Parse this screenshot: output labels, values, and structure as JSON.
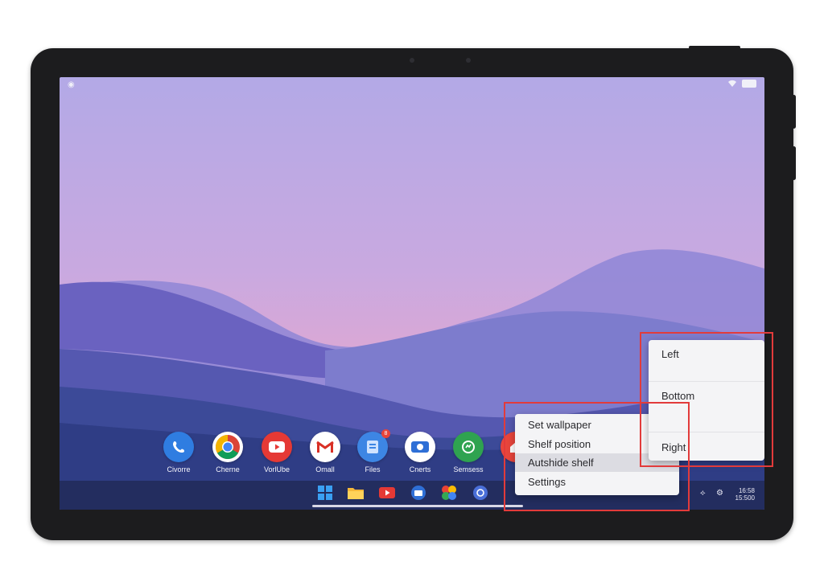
{
  "status_bar": {
    "left_icon": "status-dot-icon",
    "right_icons": [
      "wifi-icon",
      "battery-icon"
    ]
  },
  "apps": [
    {
      "label": "Civorre",
      "icon": "phone-icon",
      "color": "#2f7de1"
    },
    {
      "label": "Cherne",
      "icon": "chrome-icon",
      "color": "#ffffff"
    },
    {
      "label": "VorlUbe",
      "icon": "youtube-icon",
      "color": "#e53935"
    },
    {
      "label": "Omall",
      "icon": "gmail-icon",
      "color": "#ffffff"
    },
    {
      "label": "Files",
      "icon": "files-icon",
      "color": "#3d86e4",
      "badge": "8"
    },
    {
      "label": "Cnerts",
      "icon": "camera-icon",
      "color": "#2e6fd6"
    },
    {
      "label": "Semsess",
      "icon": "messages-icon",
      "color": "#2fa350"
    }
  ],
  "shelf": {
    "icons": [
      "windows-icon",
      "folder-icon",
      "youtube-icon",
      "store-icon",
      "photos-icon",
      "assistant-icon"
    ],
    "clock_line1": "16:58",
    "clock_line2": "15:500"
  },
  "context_menu": {
    "items": [
      "Set wallpaper",
      "Shelf position",
      "Autshide shelf",
      "Settings"
    ],
    "highlighted": "Autshide shelf"
  },
  "shelf_position_menu": {
    "items": [
      "Left",
      "Bottom",
      "Right"
    ]
  },
  "colors": {
    "annotation": "#e23b3b",
    "shelf": "#212a58",
    "menu_bg": "#f4f4f6"
  }
}
